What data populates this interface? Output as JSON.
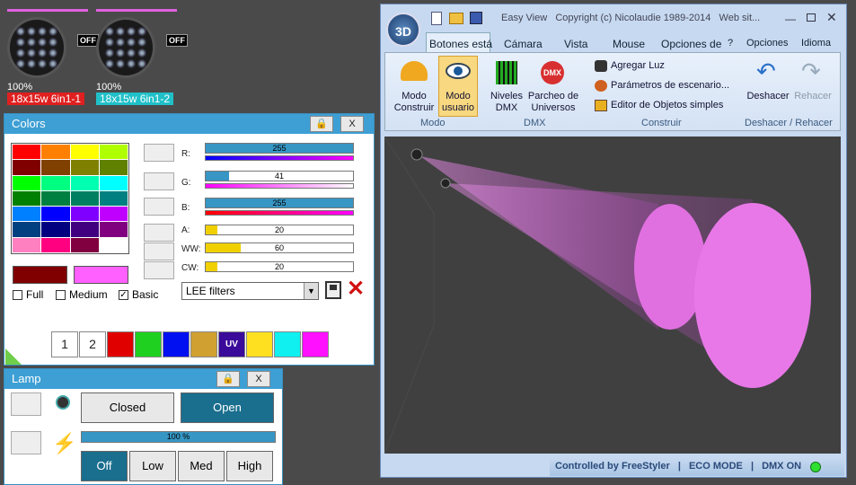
{
  "fixtures": [
    {
      "percent": "100%",
      "name": "18x15w 6in1-1",
      "status": "OFF",
      "name_color": "#e02020"
    },
    {
      "percent": "100%",
      "name": "18x15w 6in1-2",
      "status": "OFF",
      "name_color": "#20c0c8"
    }
  ],
  "colors_panel": {
    "title": "Colors",
    "lock_icon": "lock-icon",
    "close_label": "X",
    "swatches": [
      "#ff0000",
      "#ff8000",
      "#ffff00",
      "#b0ff00",
      "#800000",
      "#804000",
      "#808000",
      "#608000",
      "#00ff00",
      "#00ff80",
      "#00ffb0",
      "#00ffff",
      "#008000",
      "#008040",
      "#008060",
      "#008080",
      "#0080ff",
      "#0000ff",
      "#8000ff",
      "#c000ff",
      "#004080",
      "#000080",
      "#400080",
      "#800080",
      "#ff80c0",
      "#ff0080",
      "#800040",
      "#ffffff"
    ],
    "current_color_a": "#800000",
    "current_color_b": "#ff60ff",
    "options": [
      {
        "label": "Full",
        "checked": false
      },
      {
        "label": "Medium",
        "checked": false
      },
      {
        "label": "Basic",
        "checked": true
      }
    ],
    "channels": [
      {
        "label": "R:",
        "value": "255",
        "gradient": "linear-gradient(90deg,#00f,#f0f)"
      },
      {
        "label": "G:",
        "value": "41",
        "gradient": "linear-gradient(90deg,#f0f,#fff)"
      },
      {
        "label": "B:",
        "value": "255",
        "gradient": "linear-gradient(90deg,#f00,#f0f)"
      },
      {
        "label": "A:",
        "value": "20"
      },
      {
        "label": "WW:",
        "value": "60"
      },
      {
        "label": "CW:",
        "value": "20"
      }
    ],
    "filter_select": "LEE filters",
    "quick_buttons": [
      {
        "label": "1",
        "color": "#ffffff"
      },
      {
        "label": "2",
        "color": "#ffffff"
      },
      {
        "label": "",
        "color": "#e00000"
      },
      {
        "label": "",
        "color": "#20d020"
      },
      {
        "label": "",
        "color": "#0010f0"
      },
      {
        "label": "",
        "color": "#d0a030"
      },
      {
        "label": "UV",
        "color": "#3a0a9a"
      },
      {
        "label": "",
        "color": "#ffe020"
      },
      {
        "label": "",
        "color": "#10f0f0"
      },
      {
        "label": "",
        "color": "#ff10ff"
      }
    ]
  },
  "lamp_panel": {
    "title": "Lamp",
    "close_label": "X",
    "shutter_closed": "Closed",
    "shutter_open": "Open",
    "dimmer_value": "100 %",
    "power_buttons": [
      "Off",
      "Low",
      "Med",
      "High"
    ],
    "active_power": "Off"
  },
  "app": {
    "logo": "3D",
    "title": "Easy View   Copyright (c) Nicolaudie 1989-2014   Web sit...",
    "tabs": [
      "Botones está",
      "Cámara",
      "Vista",
      "Mouse",
      "Opciones de",
      "?",
      "Opciones",
      "Idioma"
    ],
    "ribbon": {
      "modo": {
        "label": "Modo",
        "construir": "Modo Construir",
        "usuario": "Modo usuario"
      },
      "dmx": {
        "label": "DMX",
        "niveles": "Niveles DMX",
        "parcheo": "Parcheo de Universos"
      },
      "construir": {
        "label": "Construir",
        "items": [
          "Agregar Luz",
          "Parámetros de escenario...",
          "Editor de Objetos simples"
        ]
      },
      "undo": {
        "label": "Deshacer / Rehacer",
        "deshacer": "Deshacer",
        "rehacer": "Rehacer"
      }
    },
    "status": {
      "controlled": "Controlled by FreeStyler",
      "eco": "ECO MODE",
      "dmx": "DMX ON"
    }
  }
}
